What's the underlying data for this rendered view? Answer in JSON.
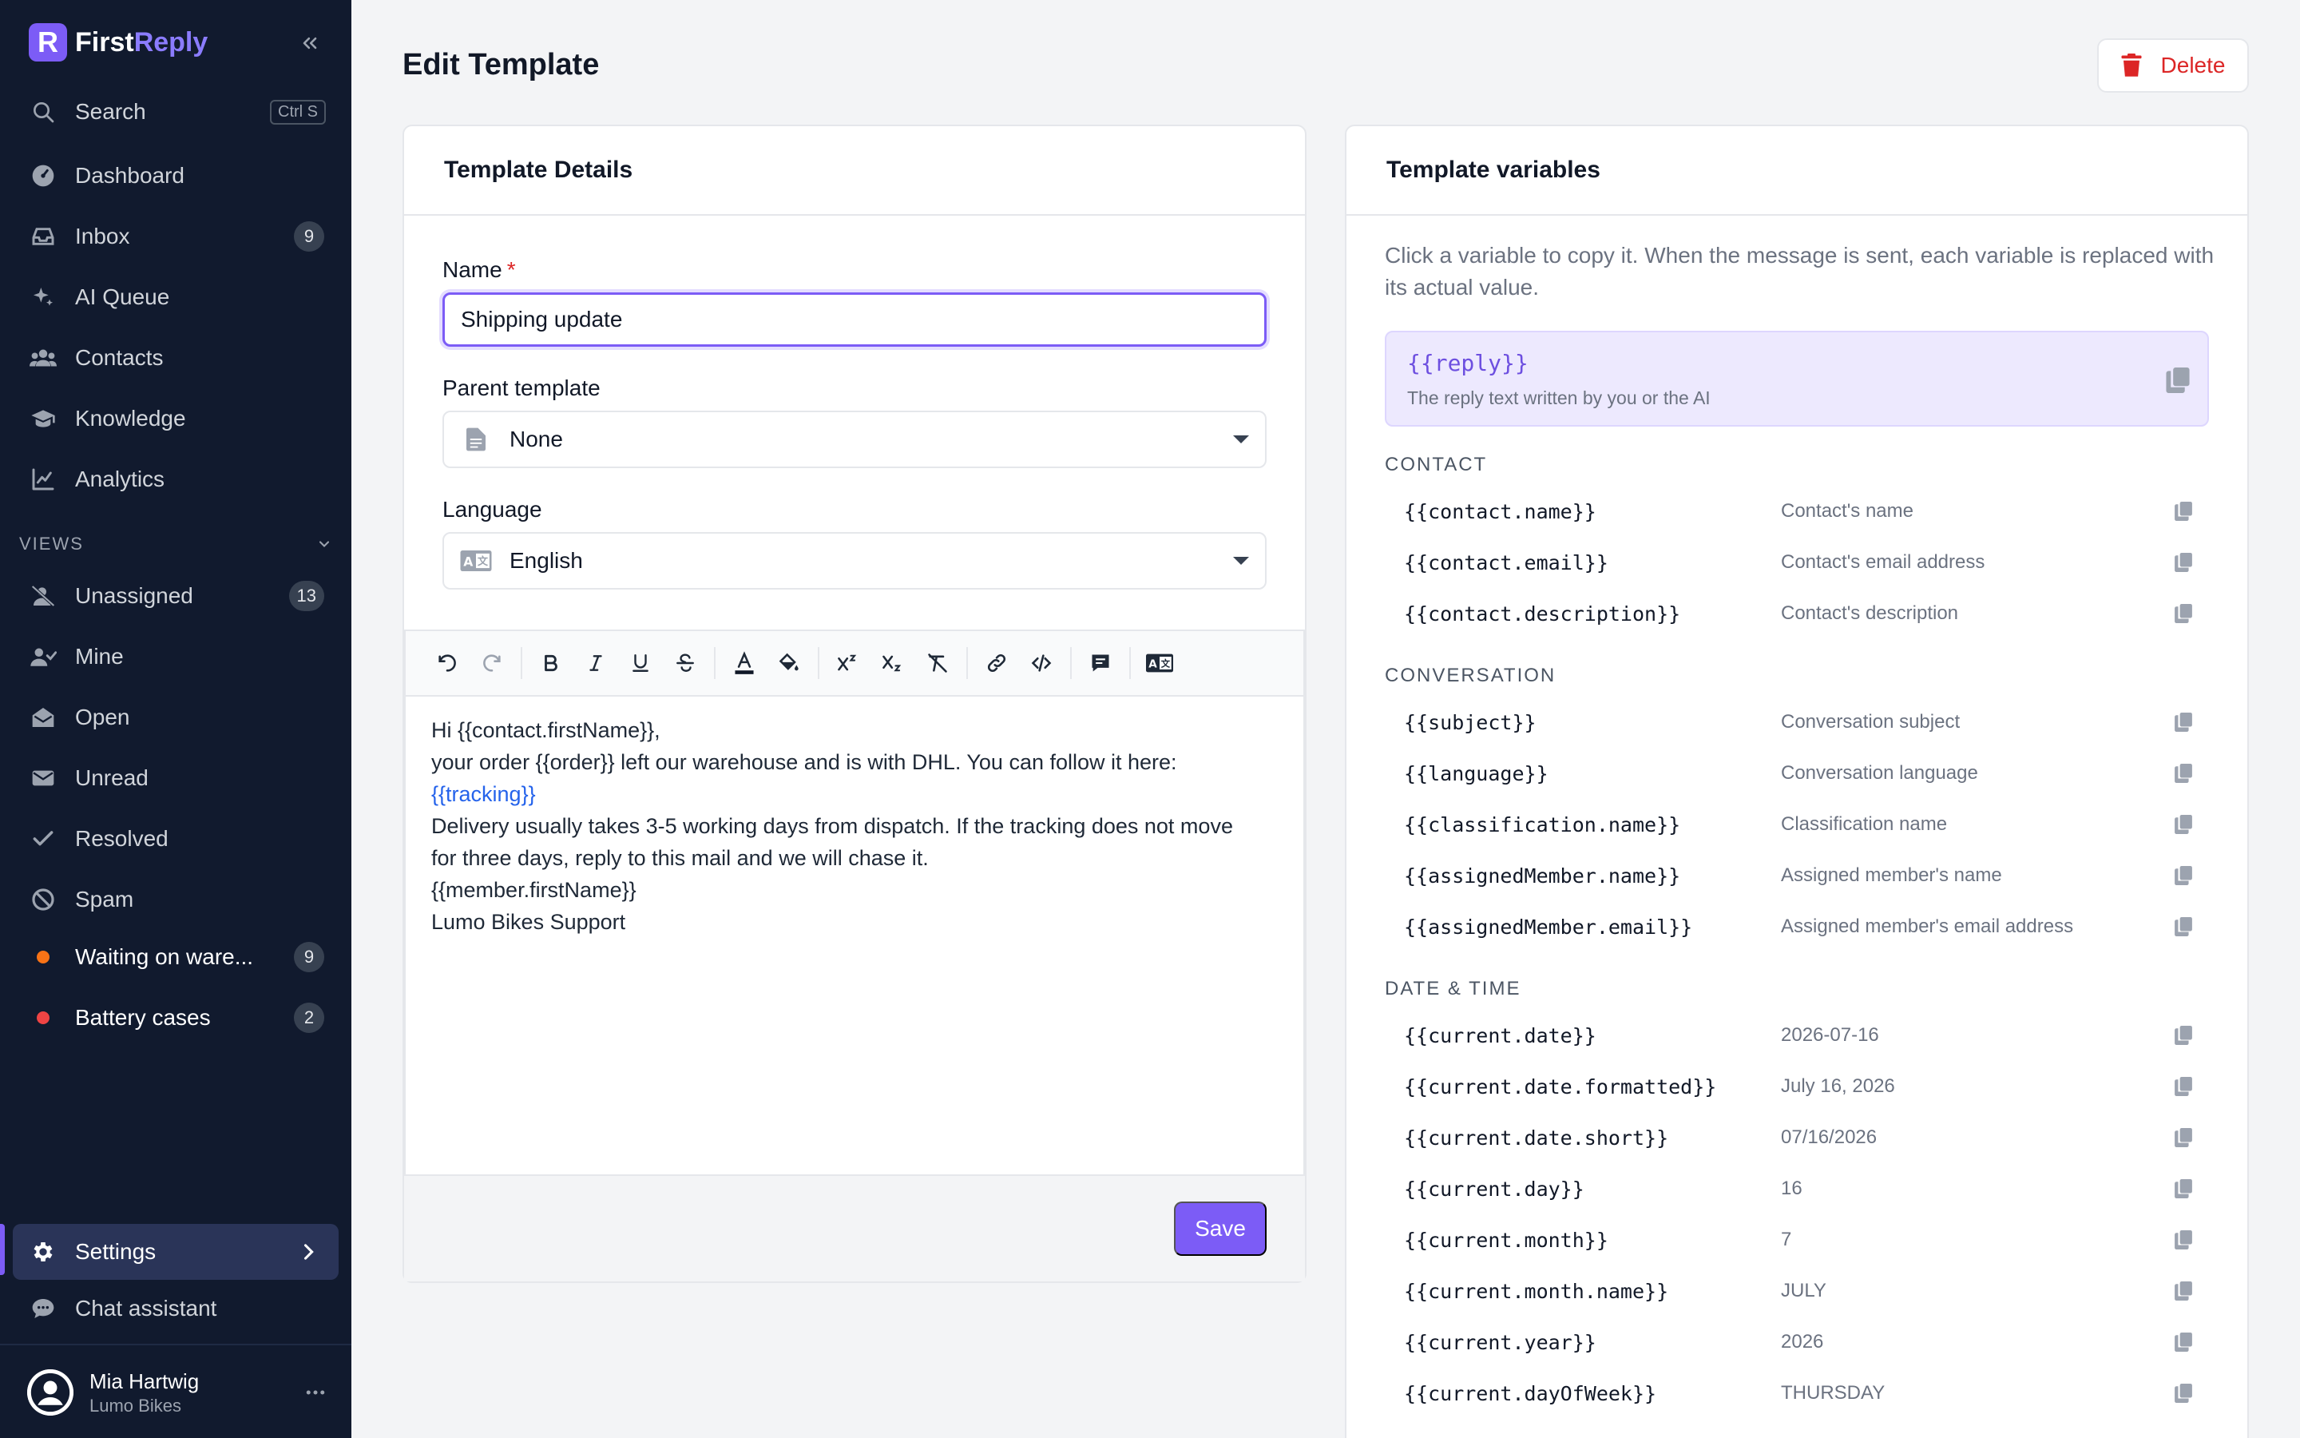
{
  "app": {
    "name_part1": "First",
    "name_part2": "Reply",
    "logo_letter": "R"
  },
  "sidebar": {
    "search": {
      "label": "Search",
      "shortcut": "Ctrl S"
    },
    "nav": [
      {
        "label": "Dashboard",
        "icon": "dashboard-icon"
      },
      {
        "label": "Inbox",
        "icon": "inbox-icon",
        "badge": "9"
      },
      {
        "label": "AI Queue",
        "icon": "sparkles-icon"
      },
      {
        "label": "Contacts",
        "icon": "users-icon"
      },
      {
        "label": "Knowledge",
        "icon": "graduation-cap-icon"
      },
      {
        "label": "Analytics",
        "icon": "chart-line-icon"
      }
    ],
    "views_header": "VIEWS",
    "views": [
      {
        "label": "Unassigned",
        "icon": "user-slash-icon",
        "badge": "13"
      },
      {
        "label": "Mine",
        "icon": "user-check-icon"
      },
      {
        "label": "Open",
        "icon": "envelope-open-icon"
      },
      {
        "label": "Unread",
        "icon": "envelope-icon"
      },
      {
        "label": "Resolved",
        "icon": "check-icon"
      },
      {
        "label": "Spam",
        "icon": "ban-icon"
      }
    ],
    "custom_views": [
      {
        "label": "Waiting on ware...",
        "badge": "9",
        "color": "#f97316"
      },
      {
        "label": "Battery cases",
        "badge": "2",
        "color": "#ef4444"
      }
    ],
    "settings": "Settings",
    "chat_assistant": "Chat assistant",
    "user": {
      "name": "Mia Hartwig",
      "org": "Lumo Bikes"
    }
  },
  "page": {
    "title": "Edit Template",
    "delete_label": "Delete"
  },
  "details": {
    "header": "Template Details",
    "name_label": "Name",
    "required_mark": "*",
    "name_value": "Shipping update",
    "parent_label": "Parent template",
    "parent_value": "None",
    "language_label": "Language",
    "language_value": "English"
  },
  "editor": {
    "lines": [
      "Hi {{contact.firstName}},",
      "your order {{order}} left our warehouse and is with DHL. You can follow it here:",
      "{{tracking}}",
      "Delivery usually takes 3-5 working days from dispatch. If the tracking does not move",
      "for three days, reply to this mail and we will chase it.",
      "{{member.firstName}}",
      "Lumo Bikes Support"
    ],
    "save_label": "Save"
  },
  "variables": {
    "header": "Template variables",
    "intro": "Click a variable to copy it. When the message is sent, each variable is replaced with its actual value.",
    "reply": {
      "code": "{{reply}}",
      "desc": "The reply text written by you or the AI"
    },
    "sections": [
      {
        "title": "CONTACT",
        "rows": [
          {
            "code": "{{contact.name}}",
            "desc": "Contact's name"
          },
          {
            "code": "{{contact.email}}",
            "desc": "Contact's email address"
          },
          {
            "code": "{{contact.description}}",
            "desc": "Contact's description"
          }
        ]
      },
      {
        "title": "CONVERSATION",
        "rows": [
          {
            "code": "{{subject}}",
            "desc": "Conversation subject"
          },
          {
            "code": "{{language}}",
            "desc": "Conversation language"
          },
          {
            "code": "{{classification.name}}",
            "desc": "Classification name"
          },
          {
            "code": "{{assignedMember.name}}",
            "desc": "Assigned member's name"
          },
          {
            "code": "{{assignedMember.email}}",
            "desc": "Assigned member's email address"
          }
        ]
      },
      {
        "title": "DATE & TIME",
        "rows": [
          {
            "code": "{{current.date}}",
            "desc": "2026-07-16"
          },
          {
            "code": "{{current.date.formatted}}",
            "desc": "July 16, 2026"
          },
          {
            "code": "{{current.date.short}}",
            "desc": "07/16/2026"
          },
          {
            "code": "{{current.day}}",
            "desc": "16"
          },
          {
            "code": "{{current.month}}",
            "desc": "7"
          },
          {
            "code": "{{current.month.name}}",
            "desc": "JULY"
          },
          {
            "code": "{{current.year}}",
            "desc": "2026"
          },
          {
            "code": "{{current.dayOfWeek}}",
            "desc": "THURSDAY"
          }
        ]
      }
    ]
  },
  "colors": {
    "accent": "#7c5cf6",
    "sidebar_bg": "#111a2e",
    "danger": "#dc2626"
  }
}
